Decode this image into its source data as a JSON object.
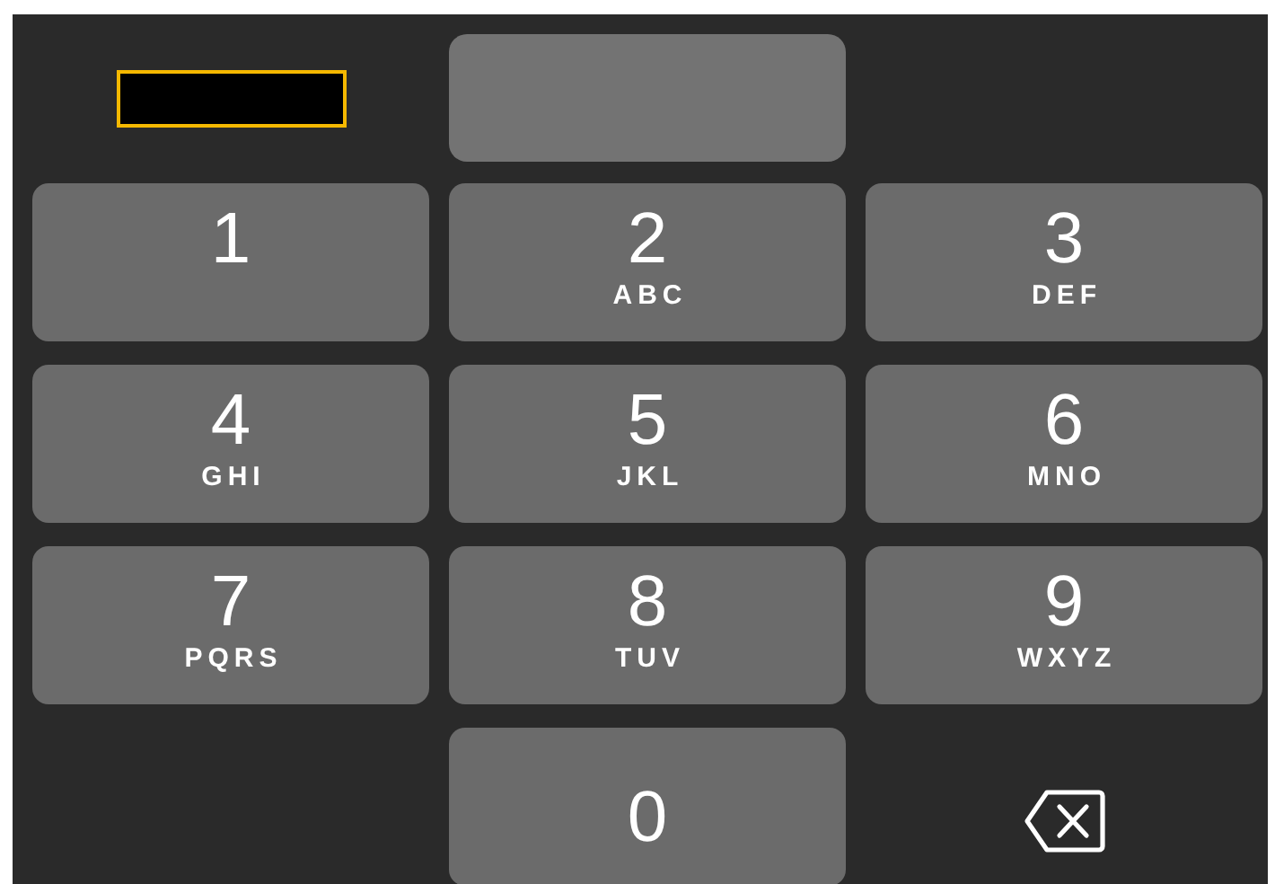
{
  "keys": [
    {
      "kind": "digit",
      "digit": "1"
    },
    {
      "kind": "digit",
      "digit": "2",
      "letters": "ABC"
    },
    {
      "kind": "digit",
      "digit": "3",
      "letters": "DEF"
    },
    {
      "kind": "digit",
      "digit": "4",
      "letters": "GHI"
    },
    {
      "kind": "digit",
      "digit": "5",
      "letters": "JKL"
    },
    {
      "kind": "digit",
      "digit": "6",
      "letters": "MNO"
    },
    {
      "kind": "digit",
      "digit": "7",
      "letters": "PQRS"
    },
    {
      "kind": "digit",
      "digit": "8",
      "letters": "TUV"
    },
    {
      "kind": "digit",
      "digit": "9",
      "letters": "WXYZ"
    },
    {
      "kind": "blank"
    },
    {
      "kind": "zero",
      "digit": "0"
    },
    {
      "kind": "delete"
    }
  ]
}
